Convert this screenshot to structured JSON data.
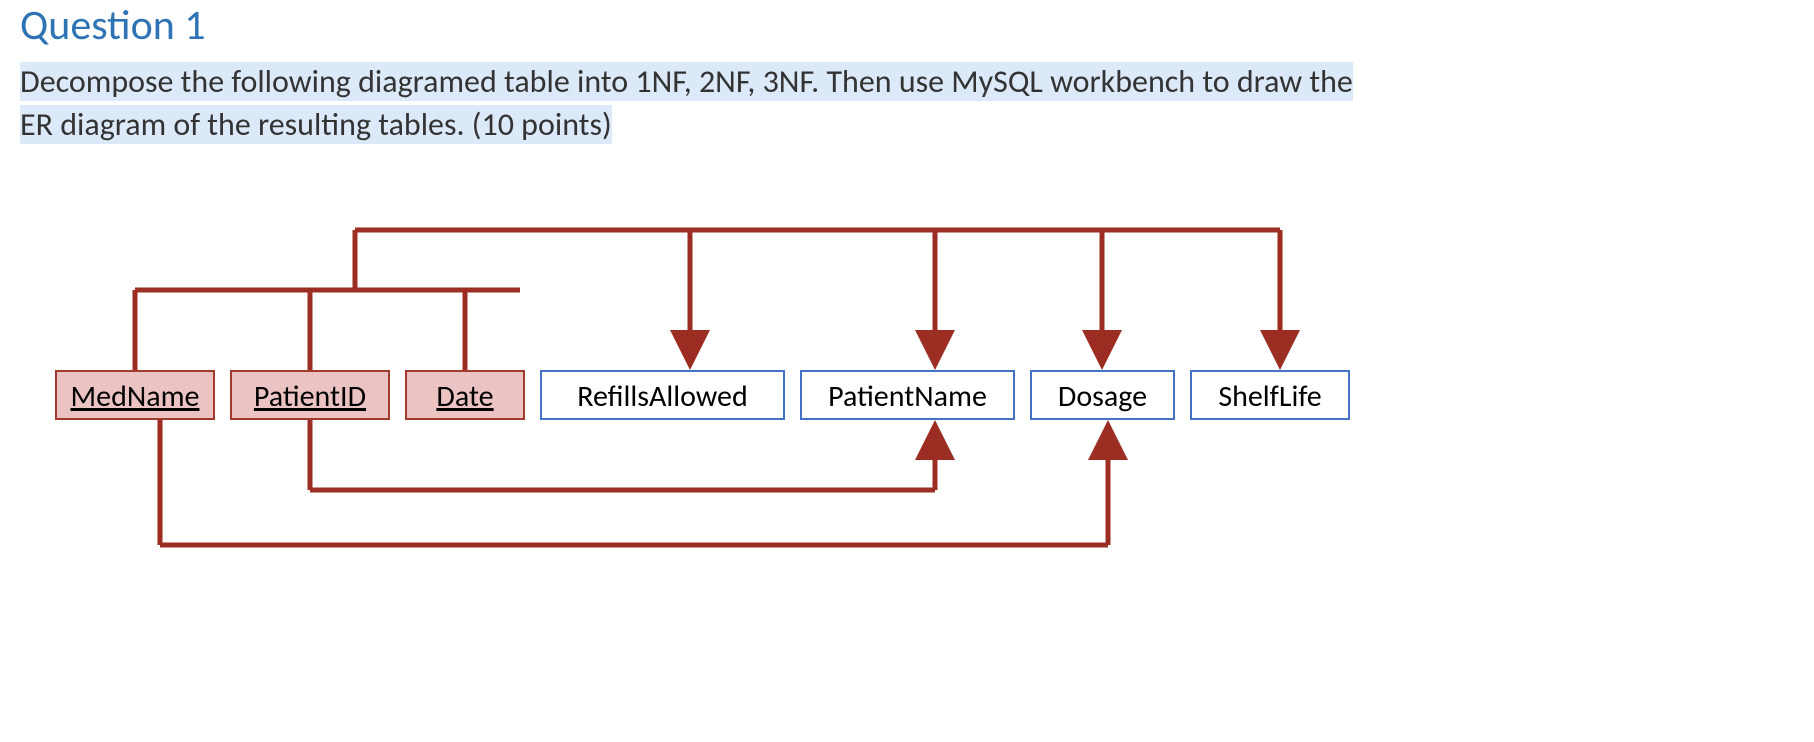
{
  "question": {
    "title": "Question 1",
    "body_highlight_1": "Decompose the following diagramed table into 1NF, 2NF, 3NF. Then use MySQL workbench to draw the",
    "body_plain_break": " ",
    "body_highlight_2": "ER diagram of the resulting tables. (10 points)"
  },
  "table": {
    "keys": {
      "medname": "MedName",
      "patientid": "PatientID",
      "date": "Date"
    },
    "attrs": {
      "refills": "RefillsAllowed",
      "patientname": "PatientName",
      "dosage": "Dosage",
      "shelflife": "ShelfLife"
    }
  },
  "colors": {
    "title": "#2E74B5",
    "highlight_bg": "#dbe9f8",
    "key_bg": "#ebc3c3",
    "key_border": "#a33a2e",
    "attr_border": "#4472C4",
    "arrow": "#9b2d23"
  },
  "dependencies": [
    {
      "from": [
        "MedName",
        "PatientID",
        "Date"
      ],
      "to": [
        "RefillsAllowed",
        "PatientName",
        "Dosage",
        "ShelfLife"
      ],
      "side": "top"
    },
    {
      "from": [
        "PatientID"
      ],
      "to": [
        "PatientName"
      ],
      "side": "bottom-inner"
    },
    {
      "from": [
        "MedName"
      ],
      "to": [
        "ShelfLife"
      ],
      "side": "bottom-outer"
    }
  ]
}
